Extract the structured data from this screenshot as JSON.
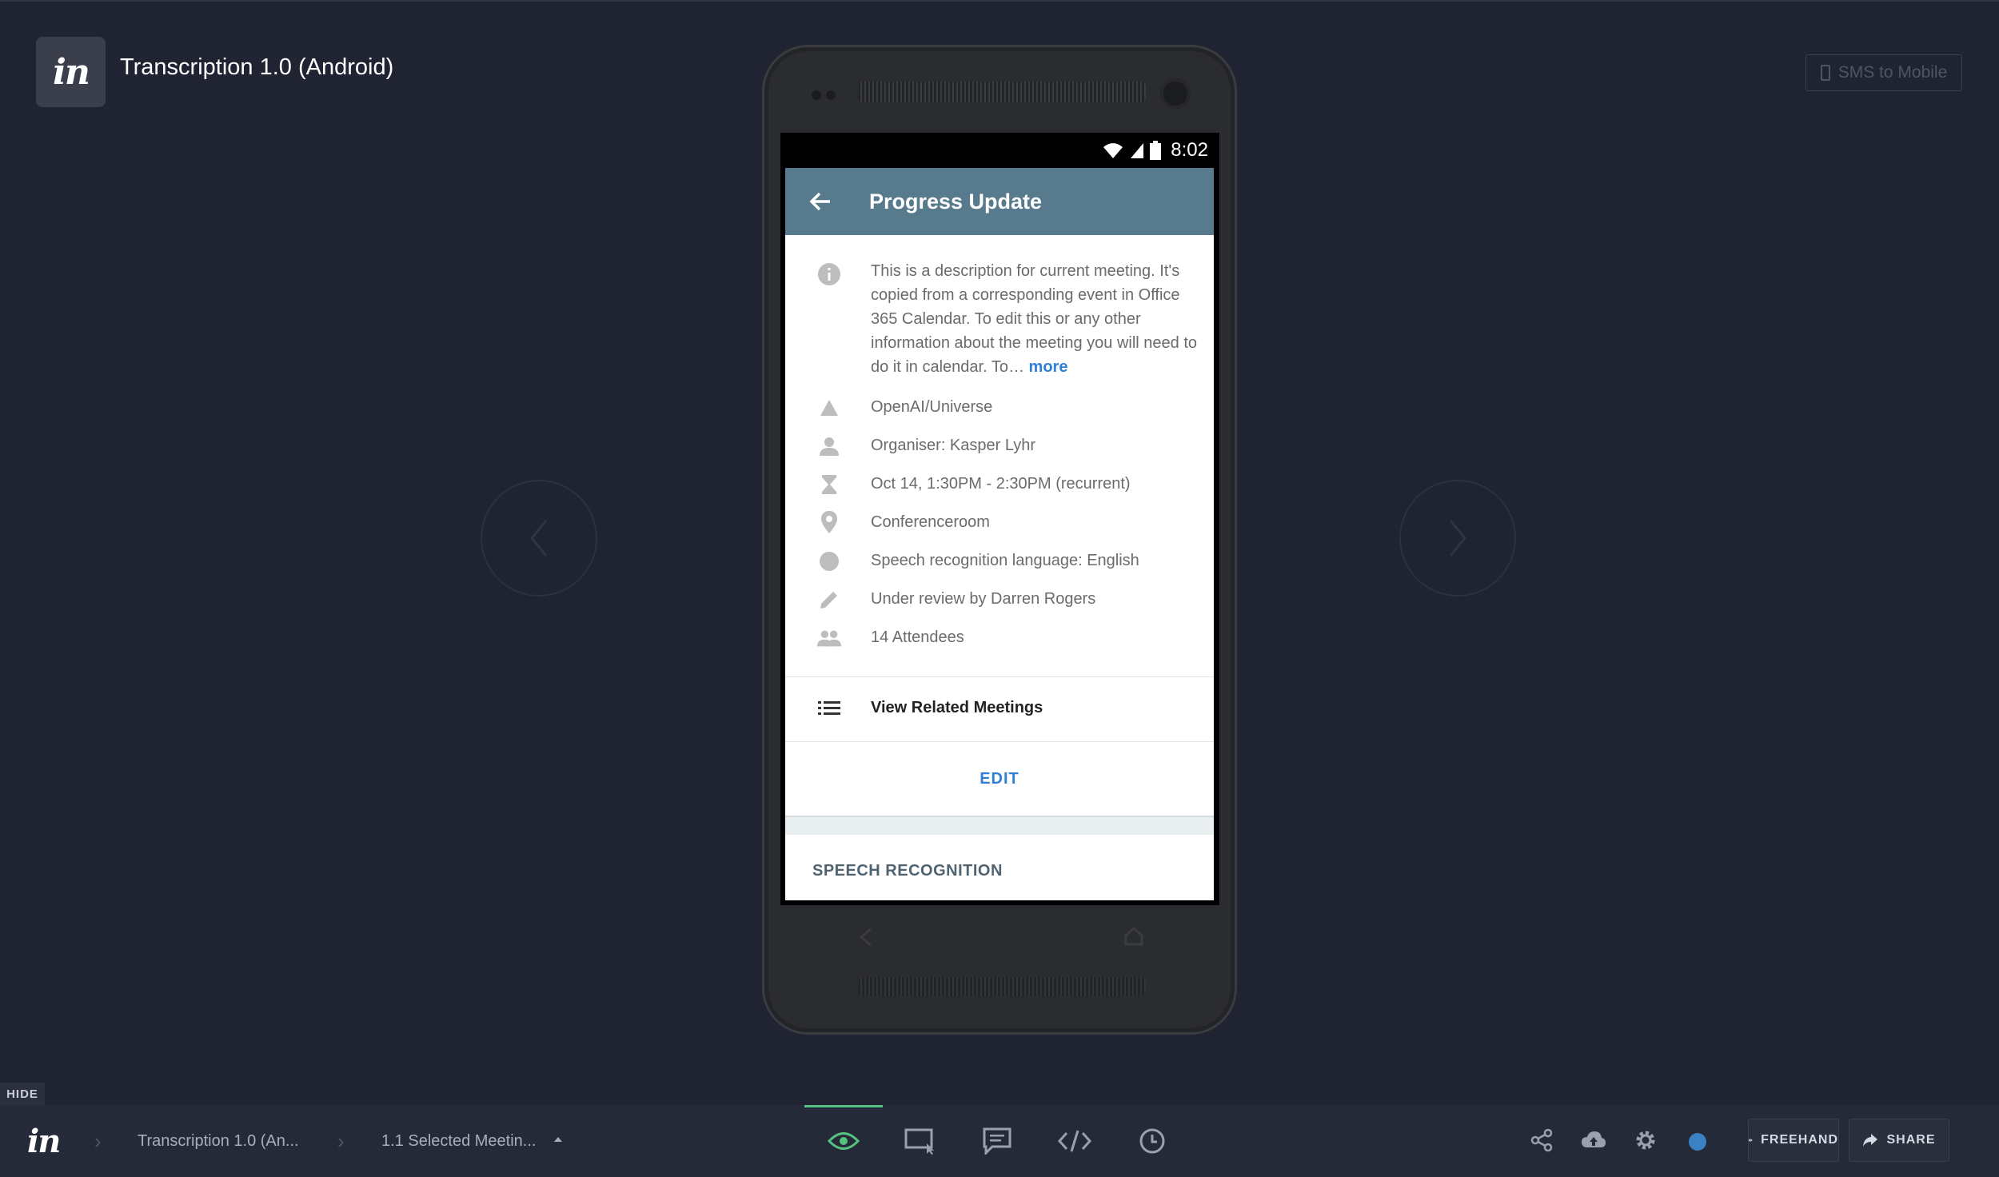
{
  "app": {
    "project_title": "Transcription 1.0 (Android)",
    "sms_button": "SMS to Mobile"
  },
  "phone_screen": {
    "status_time": "8:02",
    "title": "Progress Update",
    "description": "This is a description for current meeting. It's copied from a corresponding event in Office 365 Calendar. To edit this or any other information about the meeting you will need to do it in calendar. To…",
    "more_link": "more",
    "details": [
      {
        "icon": "triangle-icon",
        "text": "OpenAI/Universe"
      },
      {
        "icon": "person-icon",
        "text": "Organiser: Kasper Lyhr"
      },
      {
        "icon": "hourglass-icon",
        "text": "Oct 14, 1:30PM - 2:30PM (recurrent)"
      },
      {
        "icon": "location-pin-icon",
        "text": "Conferenceroom"
      },
      {
        "icon": "circle-icon",
        "text": "Speech recognition language: English"
      },
      {
        "icon": "pencil-icon",
        "text": "Under review by Darren Rogers"
      },
      {
        "icon": "people-icon",
        "text": "14 Attendees"
      }
    ],
    "related_label": "View Related Meetings",
    "edit_label": "EDIT",
    "section_label": "SPEECH RECOGNITION"
  },
  "bottombar": {
    "hide_label": "HIDE",
    "breadcrumbs": [
      "Transcription 1.0 (An...",
      "1.1 Selected Meetin..."
    ],
    "freehand_label": "FREEHAND",
    "share_label": "SHARE",
    "active_mode": "preview"
  },
  "colors": {
    "background": "#1f2332",
    "app_bar": "#587a8d",
    "link_blue": "#2f7fd8",
    "active_mode_line": "#56c27f",
    "avatar": "#3b82c4"
  }
}
